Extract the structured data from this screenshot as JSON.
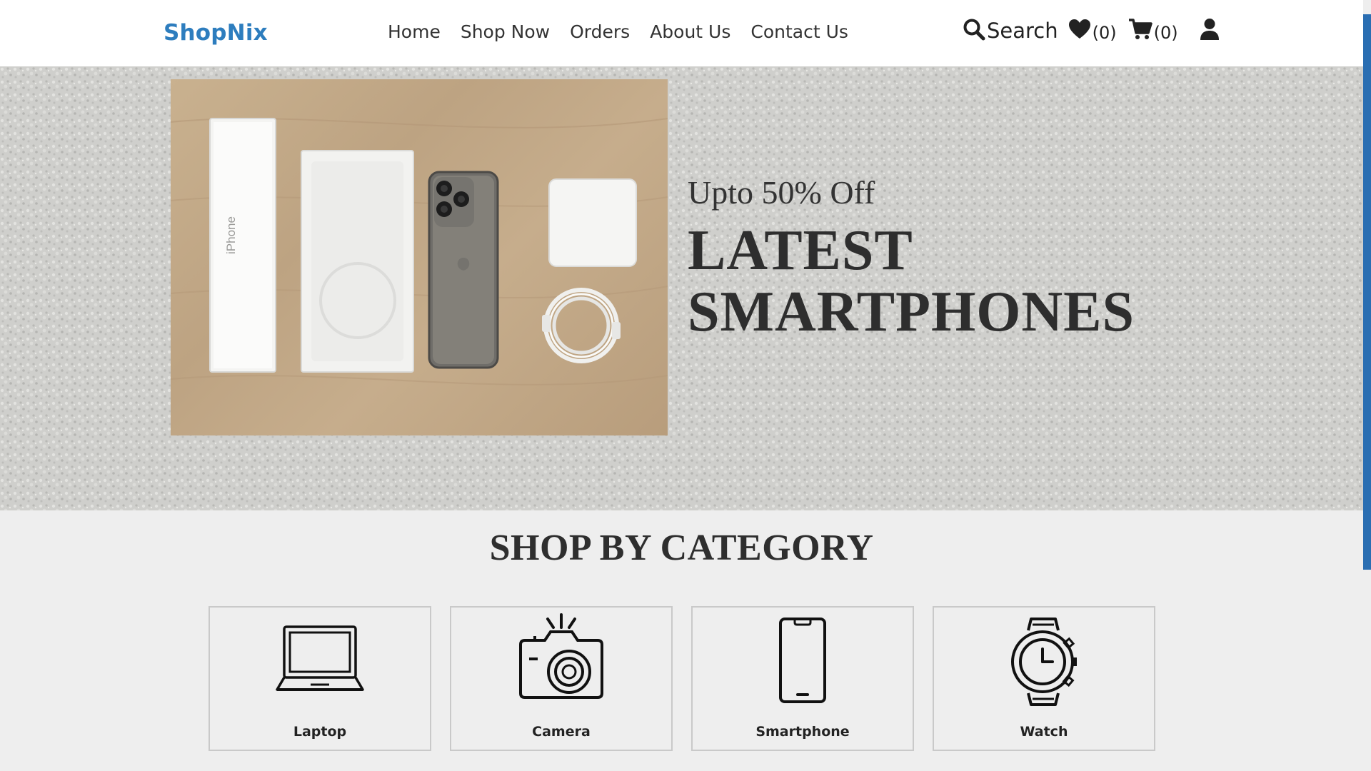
{
  "header": {
    "logo": "ShopNix",
    "nav": [
      "Home",
      "Shop Now",
      "Orders",
      "About Us",
      "Contact Us"
    ],
    "search_label": "Search",
    "wishlist_count": "(0)",
    "cart_count": "(0)"
  },
  "hero": {
    "subtitle": "Upto 50% Off",
    "title_line1": "LATEST",
    "title_line2": "SMARTPHONES",
    "box_text": "iPhone"
  },
  "categories": {
    "title": "SHOP BY CATEGORY",
    "items": [
      {
        "label": "Laptop",
        "icon": "laptop-icon"
      },
      {
        "label": "Camera",
        "icon": "camera-icon"
      },
      {
        "label": "Smartphone",
        "icon": "smartphone-icon"
      },
      {
        "label": "Watch",
        "icon": "watch-icon"
      }
    ]
  },
  "colors": {
    "brand": "#2d7dbe",
    "text": "#222222",
    "header_bg": "#ffffff",
    "page_bg": "#eeeeee"
  }
}
